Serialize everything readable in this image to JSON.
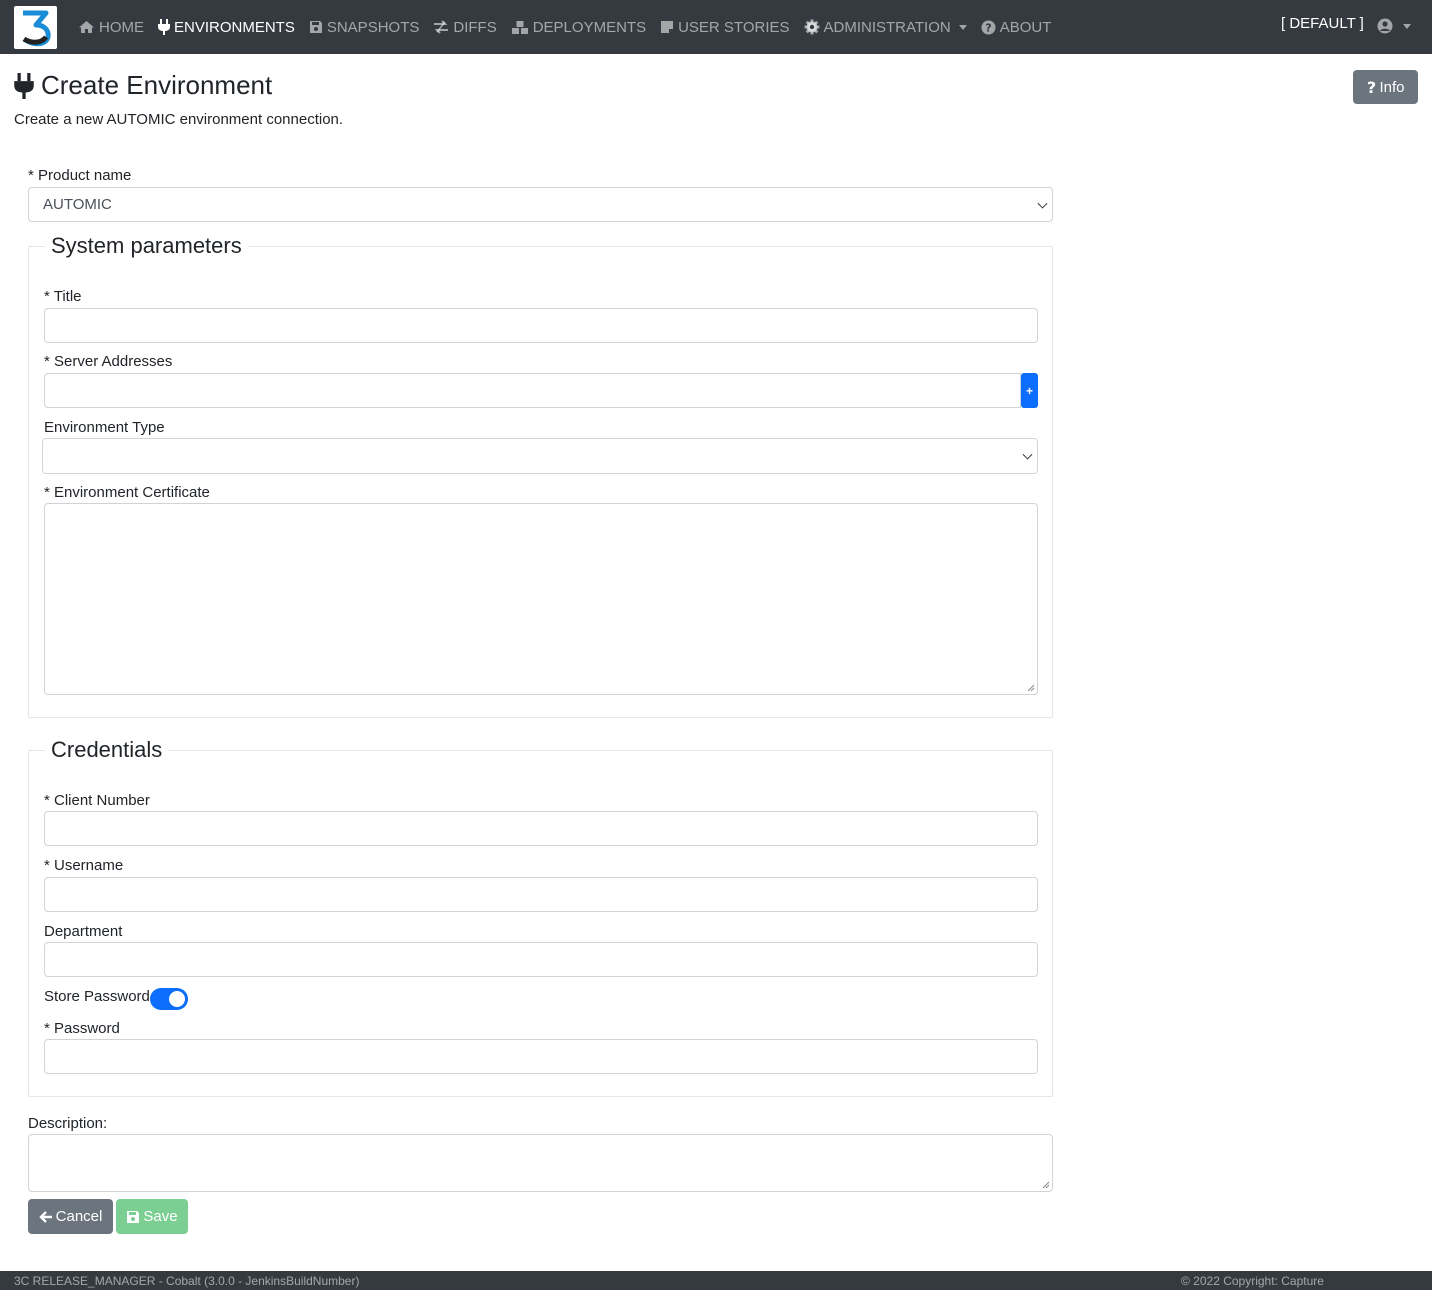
{
  "navbar": {
    "items": [
      {
        "label": "HOME",
        "icon": "home-icon"
      },
      {
        "label": "ENVIRONMENTS",
        "icon": "plug-icon"
      },
      {
        "label": "SNAPSHOTS",
        "icon": "save-icon"
      },
      {
        "label": "DIFFS",
        "icon": "diff-icon"
      },
      {
        "label": "DEPLOYMENTS",
        "icon": "cubes-icon"
      },
      {
        "label": "USER STORIES",
        "icon": "note-icon"
      },
      {
        "label": "ADMINISTRATION",
        "icon": "gear-icon"
      },
      {
        "label": "ABOUT",
        "icon": "question-circle-icon"
      }
    ],
    "active": "ENVIRONMENTS",
    "tenant": "[ DEFAULT ]"
  },
  "header": {
    "title": "Create Environment",
    "subtitle": "Create a new AUTOMIC environment connection.",
    "info_label": "Info"
  },
  "form": {
    "product": {
      "label": "* Product name",
      "value": "AUTOMIC"
    },
    "system": {
      "legend": "System parameters",
      "title_label": "* Title",
      "servers_label": "* Server Addresses",
      "add_label": "+",
      "env_type_label": "Environment Type",
      "cert_label": "* Environment Certificate"
    },
    "credentials": {
      "legend": "Credentials",
      "client_label": "* Client Number",
      "username_label": "* Username",
      "department_label": "Department",
      "store_password_label": "Store Password",
      "store_password_on": true,
      "password_label": "* Password"
    },
    "description_label": "Description:",
    "cancel_label": "Cancel",
    "save_label": "Save"
  },
  "footer": {
    "left": "3C RELEASE_MANAGER - Cobalt (3.0.0 - JenkinsBuildNumber)",
    "right": "© 2022 Copyright: Capture"
  },
  "colors": {
    "navbar": "#343a40",
    "primary": "#0d6efd",
    "secondary": "#6c757d",
    "save": "#7ccf93",
    "logo_blue": "#1a8cd8"
  }
}
